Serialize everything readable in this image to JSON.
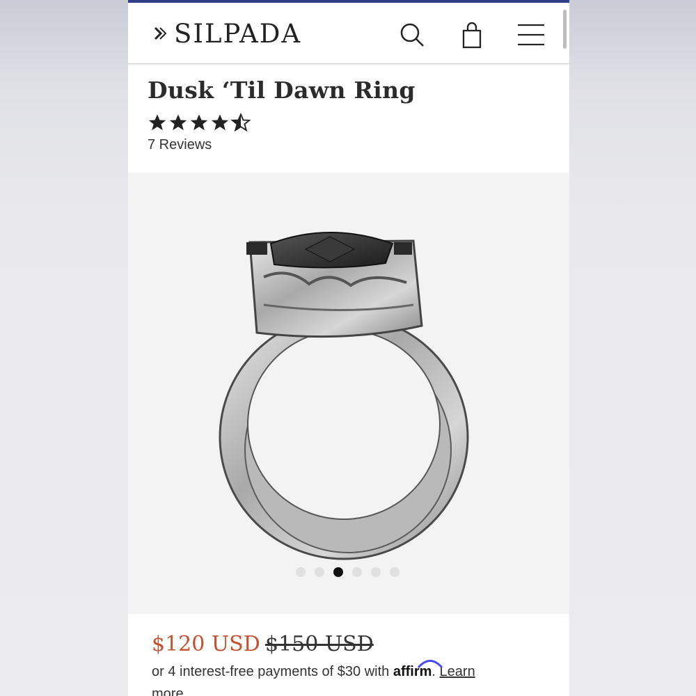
{
  "header": {
    "brand": "SILPADA",
    "icons": [
      "search-icon",
      "shopping-bag-icon",
      "menu-icon"
    ]
  },
  "product": {
    "title": "Dusk ‘Til Dawn Ring",
    "rating": 4.5,
    "rating_max": 5,
    "reviews_label": "7 Reviews"
  },
  "gallery": {
    "dot_count": 6,
    "active_index": 2
  },
  "pricing": {
    "price": "$120 USD",
    "original_price": "$150 USD",
    "installment_prefix": "or 4 interest-free payments of $30 with ",
    "affirm_label": "affirm",
    "installment_suffix": ". ",
    "learn_more_line1": "Learn",
    "learn_more_line2": "more"
  },
  "colors": {
    "accent_topline": "#2f3f8a",
    "sale_price": "#c2512f",
    "affirm_blue": "#4a4af4"
  }
}
